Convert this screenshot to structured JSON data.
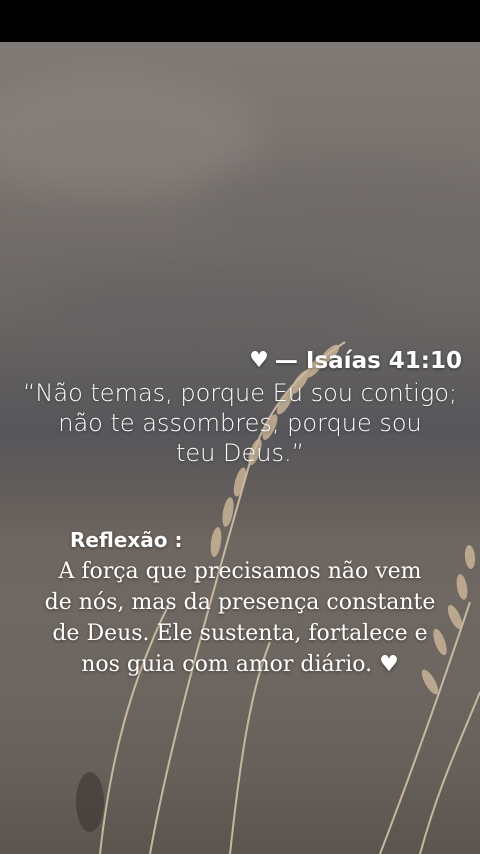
{
  "verse": {
    "heart_icon": "white-heart-icon",
    "reference": "— Isaías 41:10",
    "text": "“Não temas, porque Eu sou contigo;\nnão te assombres, porque sou\nteu Deus.”"
  },
  "reflection": {
    "title": "Reflexão :",
    "text": "A força que precisamos não vem\nde nós, mas da presença constante\nde Deus. Ele sustenta, fortalece e\nnos guia com amor diário.",
    "heart_icon": "white-heart-icon"
  },
  "colors": {
    "text": "#ffffff",
    "sky": "#77716d",
    "sea": "#57565a",
    "sand": "#6e6660"
  }
}
